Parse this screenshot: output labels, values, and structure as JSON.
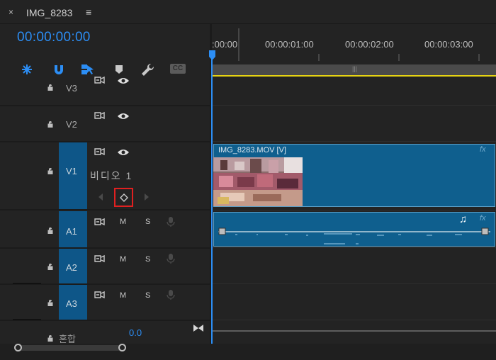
{
  "tab": {
    "title": "IMG_8283",
    "close_glyph": "×",
    "menu_glyph": "≡"
  },
  "timecode": "00:00:00:00",
  "tools": [
    "snap-insert-icon",
    "magnet-icon",
    "linked-select-icon",
    "marker-icon",
    "wrench-icon",
    "captions-icon"
  ],
  "tool_captions_label": "CC",
  "ruler": {
    "labels": [
      ":00:00",
      "00:00:01:00",
      "00:00:02:00",
      "00:00:03:00"
    ]
  },
  "tracks": {
    "v3": {
      "name": "V3"
    },
    "v2": {
      "name": "V2"
    },
    "v1": {
      "name": "V1",
      "sublabel": "비디오 1"
    },
    "a1": {
      "name": "A1",
      "m": "M",
      "s": "S"
    },
    "a2": {
      "name": "A2",
      "m": "M",
      "s": "S"
    },
    "a3": {
      "name": "A3",
      "m": "M",
      "s": "S"
    },
    "mix": {
      "name": "혼합",
      "value": "0.0"
    }
  },
  "clips": {
    "video": {
      "label": "IMG_8283.MOV [V]",
      "fx": "fx"
    },
    "audio": {
      "fx": "fx",
      "note_glyph": "♫"
    }
  },
  "colors": {
    "accent": "#2c8ef5",
    "track_target": "#0e5688",
    "clip": "#0f5f8e",
    "work_area": "#e6d313",
    "keyframe_highlight": "#e02020"
  }
}
